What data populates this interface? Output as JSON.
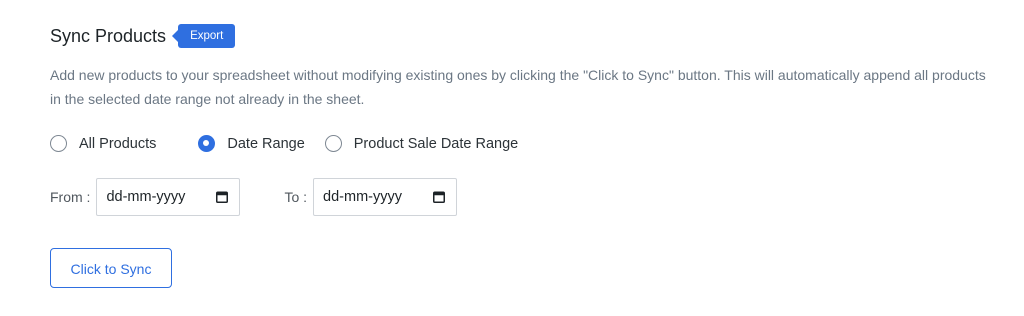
{
  "section": {
    "title": "Sync Products",
    "badge": "Export",
    "description": "Add new products to your spreadsheet without modifying existing ones by clicking the \"Click to Sync\" button. This will automatically append all products in the selected date range not already in the sheet."
  },
  "options": [
    {
      "label": "All Products",
      "checked": false
    },
    {
      "label": "Date Range",
      "checked": true
    },
    {
      "label": "Product Sale Date Range",
      "checked": false
    }
  ],
  "dates": {
    "from_label": "From :",
    "from_placeholder": "dd-mm-yyyy",
    "to_label": "To :",
    "to_placeholder": "dd-mm-yyyy"
  },
  "sync_button": "Click to Sync",
  "colors": {
    "accent": "#2f6fe0",
    "text": "#1d2327",
    "muted": "#6b7784"
  }
}
